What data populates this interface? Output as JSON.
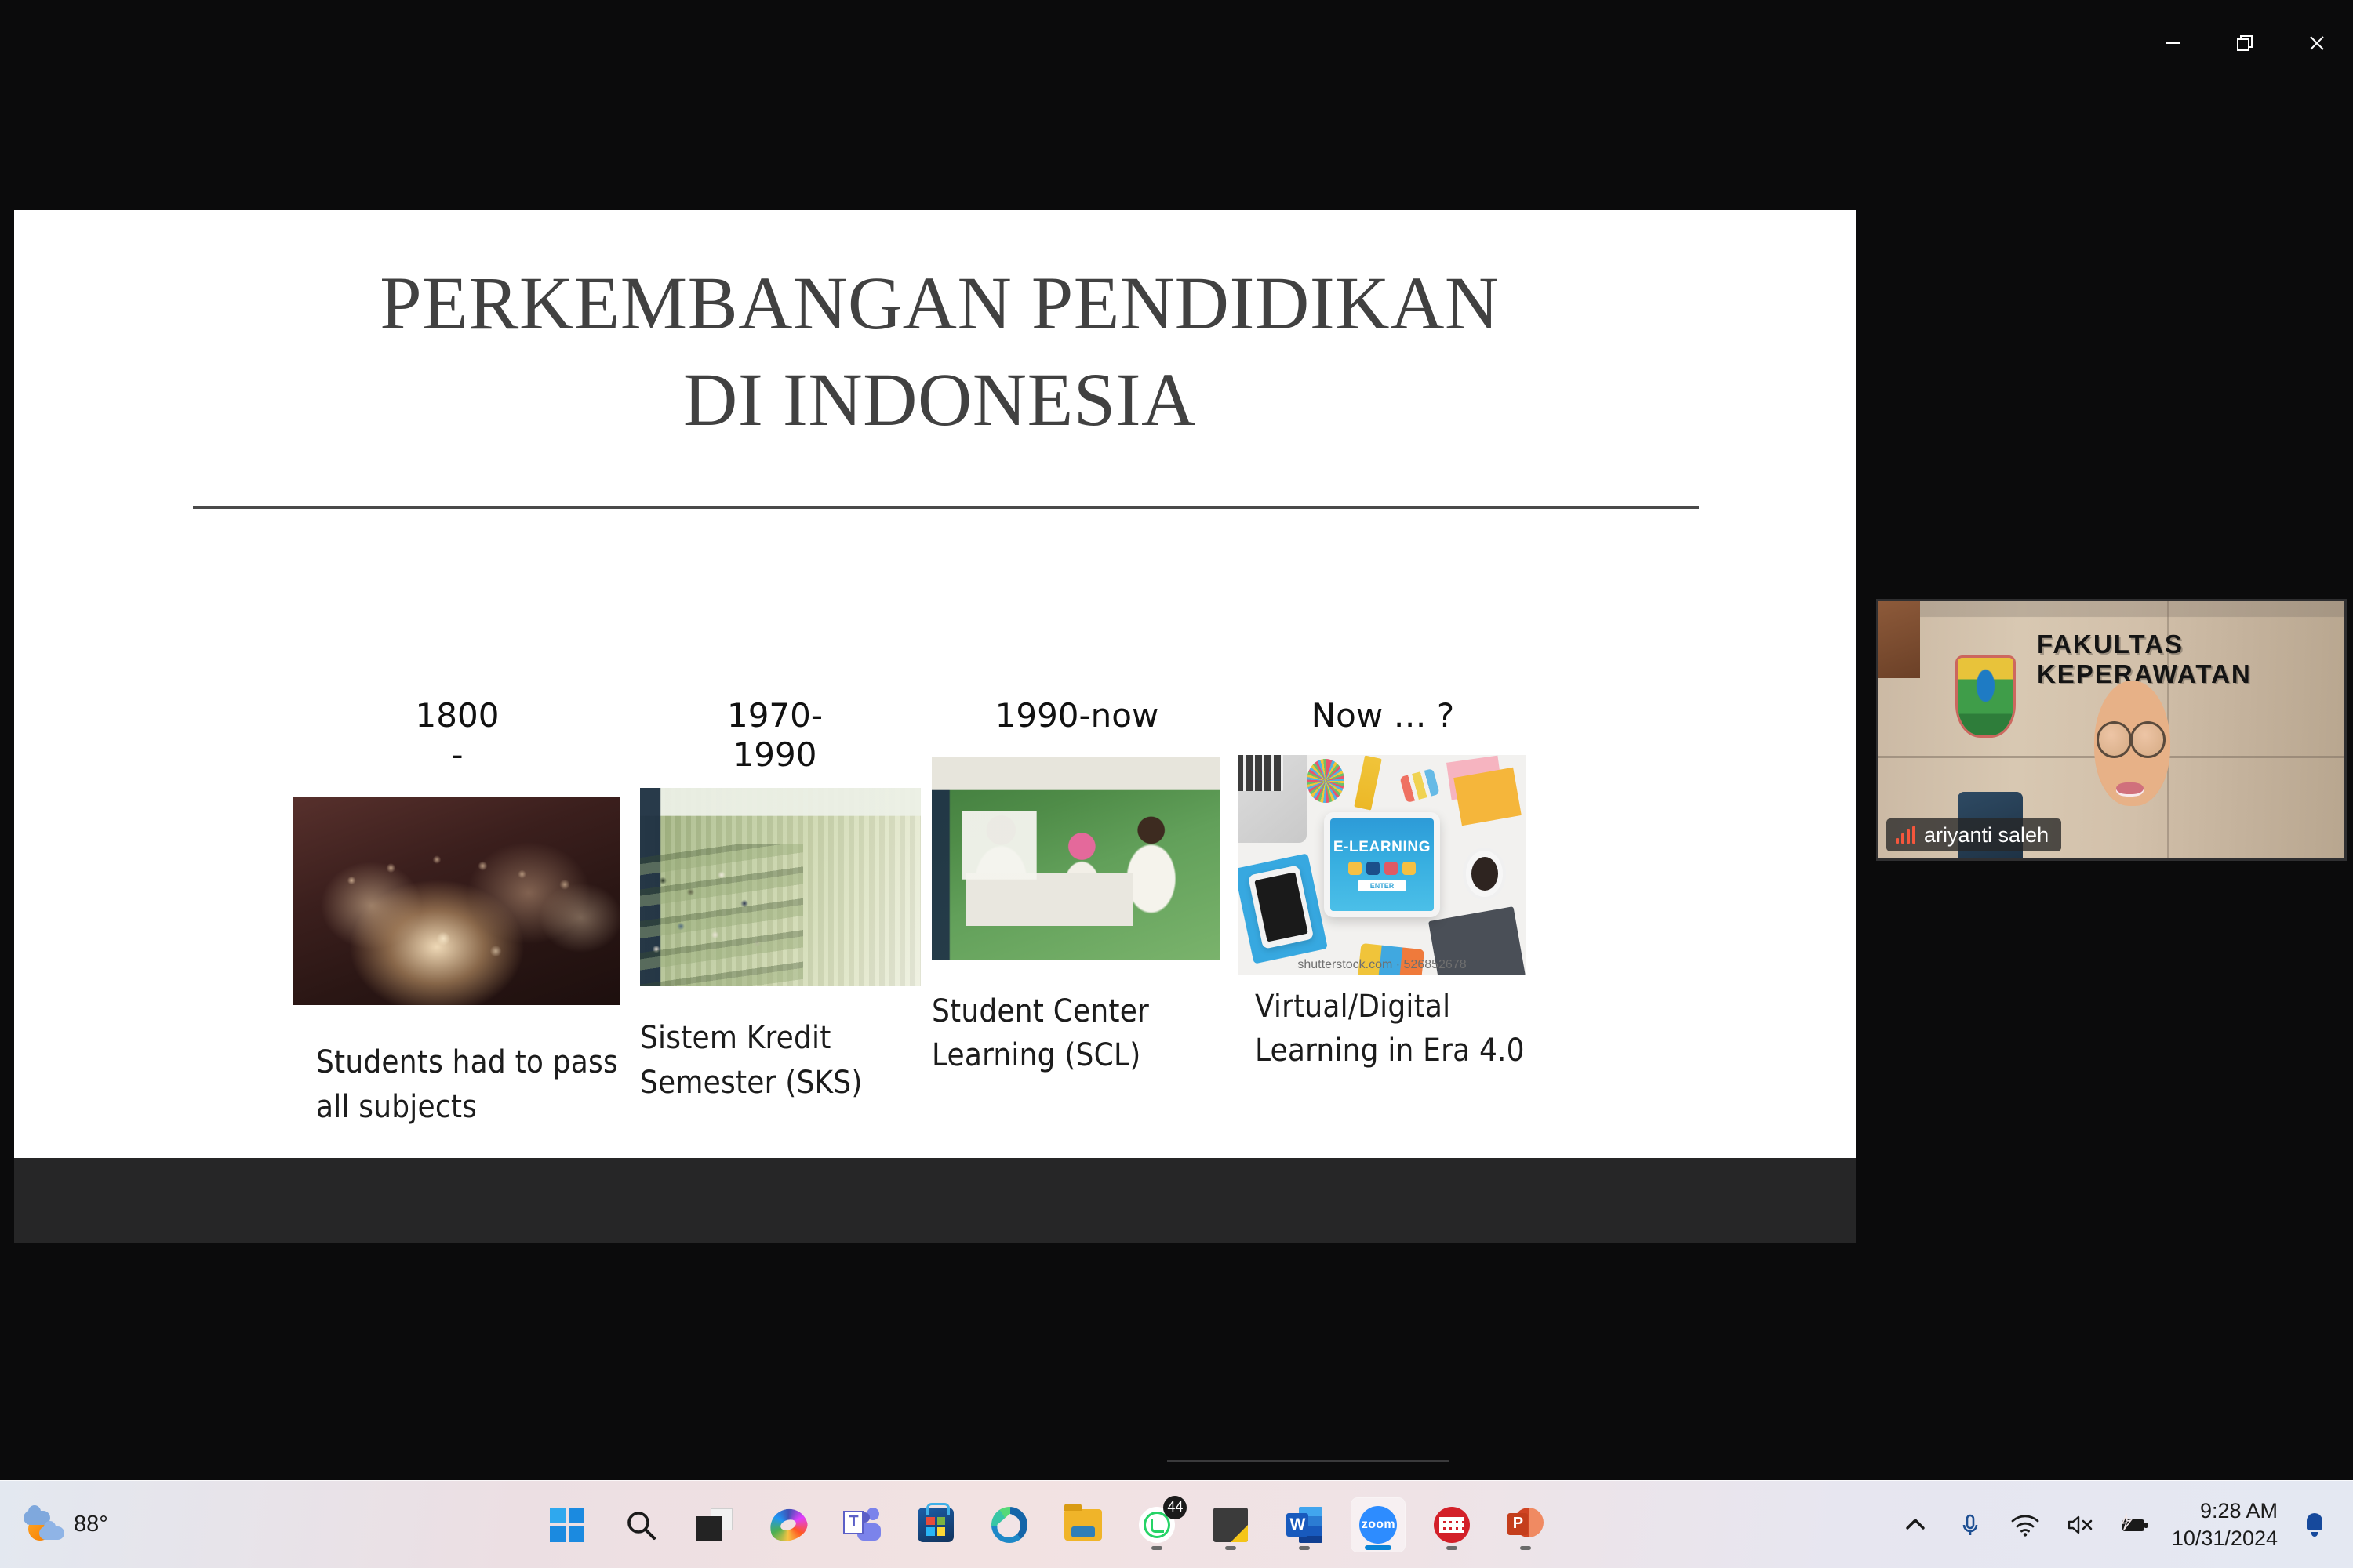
{
  "window": {
    "controls": [
      {
        "name": "minimize",
        "glyph": "minimize-icon"
      },
      {
        "name": "restore",
        "glyph": "restore-icon"
      },
      {
        "name": "close",
        "glyph": "close-icon"
      }
    ]
  },
  "slide": {
    "title": "PERKEMBANGAN PENDIDIKAN DI INDONESIA",
    "title_line1": "PERKEMBANGAN PENDIDIKAN",
    "title_line2": "DI INDONESIA",
    "columns": [
      {
        "period": "1800\n-",
        "caption": "Students had to pass all subjects",
        "image_alt": "historic-surgery-painting"
      },
      {
        "period": "1970-\n1990",
        "caption": "Sistem Kredit Semester (SKS)",
        "image_alt": "lecture-hall-classroom"
      },
      {
        "period": "1990-now",
        "caption": "Student Center Learning (SCL)",
        "image_alt": "nursing-skills-lab"
      },
      {
        "period": "Now … ?",
        "caption": "Virtual/Digital Learning in Era 4.0",
        "image_alt": "e-learning-tablet-flatlay",
        "image_text": "E-LEARNING",
        "image_button": "ENTER",
        "image_watermark": "shutterstock.com · 526852678"
      }
    ]
  },
  "webcam": {
    "participant_name": "ariyanti saleh",
    "wall_text_line1": "FAKULTAS",
    "wall_text_line2": "KEPERAWATAN",
    "audio_indicator": "audio-level-bars",
    "accent_color": "#f4563c"
  },
  "taskbar": {
    "weather": {
      "temperature": "88°",
      "icon": "partly-cloudy-icon"
    },
    "apps": [
      {
        "name": "start",
        "icon": "windows-start-icon",
        "label": "Start",
        "running": false,
        "active": false
      },
      {
        "name": "search",
        "icon": "search-icon",
        "label": "Search",
        "running": false,
        "active": false
      },
      {
        "name": "task-view",
        "icon": "task-view-icon",
        "label": "Task View",
        "running": false,
        "active": false
      },
      {
        "name": "copilot",
        "icon": "copilot-icon",
        "label": "Copilot",
        "running": false,
        "active": false
      },
      {
        "name": "teams",
        "icon": "teams-icon",
        "label": "Microsoft Teams",
        "running": false,
        "active": false
      },
      {
        "name": "store",
        "icon": "microsoft-store-icon",
        "label": "Microsoft Store",
        "running": false,
        "active": false
      },
      {
        "name": "edge",
        "icon": "edge-icon",
        "label": "Microsoft Edge",
        "running": false,
        "active": false
      },
      {
        "name": "file-explorer",
        "icon": "folder-icon",
        "label": "File Explorer",
        "running": false,
        "active": false
      },
      {
        "name": "whatsapp",
        "icon": "whatsapp-icon",
        "label": "WhatsApp",
        "running": true,
        "active": false,
        "badge": "44"
      },
      {
        "name": "sticky-notes",
        "icon": "sticky-notes-icon",
        "label": "Sticky Notes",
        "running": true,
        "active": false
      },
      {
        "name": "word",
        "icon": "word-icon",
        "label": "Microsoft Word",
        "running": true,
        "active": false
      },
      {
        "name": "zoom",
        "icon": "zoom-icon",
        "label": "zoom",
        "running": true,
        "active": true
      },
      {
        "name": "keyboard-app",
        "icon": "keyboard-icon",
        "label": "Keyboard",
        "running": true,
        "active": false
      },
      {
        "name": "powerpoint",
        "icon": "powerpoint-icon",
        "label": "Microsoft PowerPoint",
        "running": true,
        "active": false
      }
    ],
    "tray": [
      {
        "name": "show-hidden-icons",
        "icon": "chevron-up-icon"
      },
      {
        "name": "microphone",
        "icon": "microphone-icon"
      },
      {
        "name": "network",
        "icon": "wifi-icon"
      },
      {
        "name": "volume",
        "icon": "speaker-muted-icon"
      },
      {
        "name": "battery",
        "icon": "battery-charging-icon"
      }
    ],
    "clock": {
      "time": "9:28 AM",
      "date": "10/31/2024"
    },
    "notifications": {
      "icon": "bell-icon"
    }
  }
}
